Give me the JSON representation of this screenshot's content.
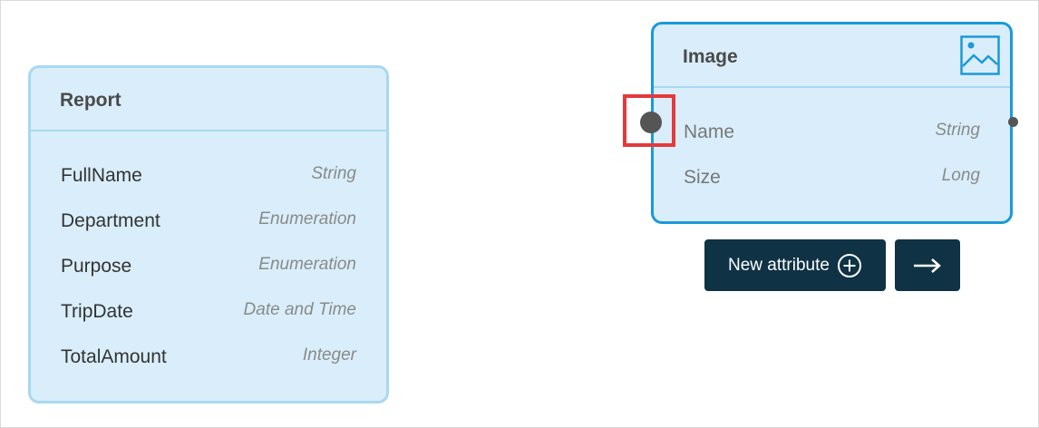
{
  "report": {
    "title": "Report",
    "attributes": [
      {
        "name": "FullName",
        "type": "String"
      },
      {
        "name": "Department",
        "type": "Enumeration"
      },
      {
        "name": "Purpose",
        "type": "Enumeration"
      },
      {
        "name": "TripDate",
        "type": "Date and Time"
      },
      {
        "name": "TotalAmount",
        "type": "Integer"
      }
    ]
  },
  "image": {
    "title": "Image",
    "icon": "image-icon",
    "attributes": [
      {
        "name": "Name",
        "type": "String"
      },
      {
        "name": "Size",
        "type": "Long"
      }
    ]
  },
  "actions": {
    "new_attribute_label": "New attribute",
    "new_attribute_icon": "plus-circle-icon",
    "next_icon": "arrow-right-icon"
  },
  "colors": {
    "entity_fill": "#d9eefa",
    "entity_border": "#a8d8f2",
    "selected_border": "#1a99da",
    "button_bg": "#0f3245",
    "highlight": "#e4393c"
  }
}
